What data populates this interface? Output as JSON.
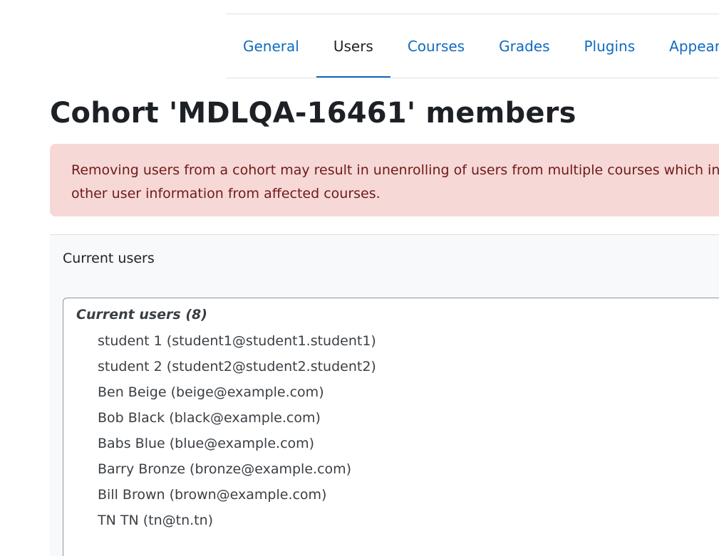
{
  "nav": {
    "tabs": [
      {
        "label": "General"
      },
      {
        "label": "Users"
      },
      {
        "label": "Courses"
      },
      {
        "label": "Grades"
      },
      {
        "label": "Plugins"
      },
      {
        "label": "Appearance"
      }
    ],
    "active_tab": "Users"
  },
  "page": {
    "title": "Cohort 'MDLQA-16461' members"
  },
  "alert": {
    "line1": "Removing users from a cohort may result in unenrolling of users from multiple courses which includes deleting user settings, grades, group membership and",
    "line2": "other user information from affected courses."
  },
  "current_users": {
    "section_label": "Current users",
    "group_label": "Current users (8)",
    "options": [
      "student 1 (student1@student1.student1)",
      "student 2 (student2@student2.student2)",
      "Ben Beige (beige@example.com)",
      "Bob Black (black@example.com)",
      "Babs Blue (blue@example.com)",
      "Barry Bronze (bronze@example.com)",
      "Bill Brown (brown@example.com)",
      "TN TN (tn@tn.tn)"
    ]
  },
  "colors": {
    "link": "#0f6cbf",
    "alert_bg": "#f6d8d6",
    "alert_text": "#6e1a1a"
  }
}
